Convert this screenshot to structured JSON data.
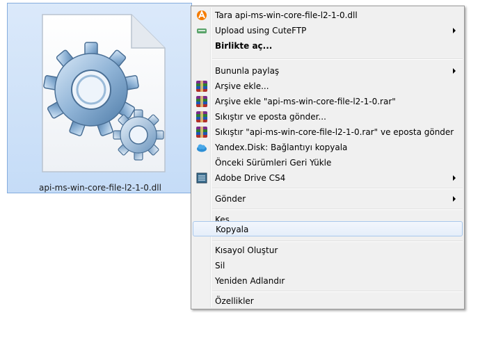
{
  "file": {
    "name": "api-ms-win-core-file-l2-1-0.dll",
    "icon": "dll-gear-file-icon"
  },
  "menu": {
    "items": [
      {
        "label": "Tara api-ms-win-core-file-l2-1-0.dll",
        "icon": "avast-icon",
        "submenu": false,
        "bold": false
      },
      {
        "label": "Upload using CuteFTP",
        "icon": "cuteftp-icon",
        "submenu": true,
        "bold": false
      },
      {
        "label": "Birlikte aç...",
        "icon": "",
        "submenu": false,
        "bold": true
      },
      {
        "label": "Bununla paylaş",
        "icon": "",
        "submenu": true,
        "bold": false
      },
      {
        "label": "Arşive ekle...",
        "icon": "winrar-icon",
        "submenu": false,
        "bold": false
      },
      {
        "label": "Arşive ekle \"api-ms-win-core-file-l2-1-0.rar\"",
        "icon": "winrar-icon",
        "submenu": false,
        "bold": false
      },
      {
        "label": "Sıkıştır ve eposta gönder...",
        "icon": "winrar-icon",
        "submenu": false,
        "bold": false
      },
      {
        "label": "Sıkıştır \"api-ms-win-core-file-l2-1-0.rar\" ve eposta gönder",
        "icon": "winrar-icon",
        "submenu": false,
        "bold": false
      },
      {
        "label": "Yandex.Disk: Bağlantıyı kopyala",
        "icon": "yandex-disk-icon",
        "submenu": false,
        "bold": false
      },
      {
        "label": "Önceki Sürümleri Geri Yükle",
        "icon": "",
        "submenu": false,
        "bold": false
      },
      {
        "label": "Adobe Drive CS4",
        "icon": "adobe-drive-icon",
        "submenu": true,
        "bold": false
      },
      {
        "label": "Gönder",
        "icon": "",
        "submenu": true,
        "bold": false
      },
      {
        "label": "Kes",
        "icon": "",
        "submenu": false,
        "bold": false
      },
      {
        "label": "Kopyala",
        "icon": "",
        "submenu": false,
        "bold": false,
        "hovered": true
      },
      {
        "label": "Kısayol Oluştur",
        "icon": "",
        "submenu": false,
        "bold": false
      },
      {
        "label": "Sil",
        "icon": "",
        "submenu": false,
        "bold": false
      },
      {
        "label": "Yeniden Adlandır",
        "icon": "",
        "submenu": false,
        "bold": false
      },
      {
        "label": "Özellikler",
        "icon": "",
        "submenu": false,
        "bold": false
      }
    ]
  },
  "colors": {
    "selection_fill": "#c5dcf7",
    "selection_border": "#84acdd",
    "menu_background": "#f0f0f0",
    "hover_border": "#a8c8ec"
  }
}
